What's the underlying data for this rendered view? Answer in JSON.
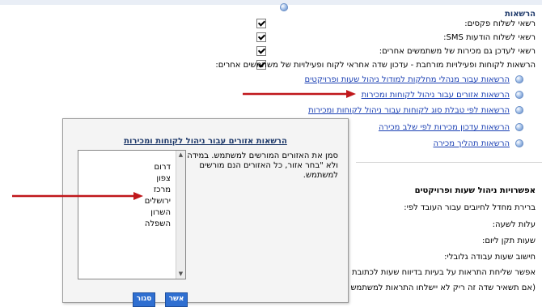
{
  "section_title": "הרשאות",
  "checkbox_rows": [
    {
      "label": "רשאי לשלוח פקסים:",
      "checked": true
    },
    {
      "label": "רשאי לשלוח הודעות SMS:",
      "checked": true
    },
    {
      "label": "רשאי לעדכן גם מכירות של משתמשים אחרים:",
      "checked": true
    },
    {
      "label": "הרשאות לקוחות ופעילויות מורחבת - עדכון שדה אחראי לקוח ופעילויות של משתמשים אחרים:",
      "checked": true
    }
  ],
  "links": [
    "הרשאות עבור מנהלי מחלקות למודול ניהול שעות ופרויקטים",
    "הרשאות אזורים עבור ניהול לקוחות ומכירות",
    "הרשאות לפי טבלת סוג לקוחות עבור ניהול לקוחות ומכירות",
    "הרשאות עדכון מכירות לפי שלב מכירה",
    "הרשאות תהליך מכירה"
  ],
  "subsection_title": "אפשרויות ניהול שעות ופרויקטים",
  "info_rows": [
    "ברירת מחדל לחיובים עבור העובד לפי:",
    "עלות לשעה:",
    "שעות תקן ליום:",
    "חישוב שעות עבודה גלובלי:",
    "אפשר שליחת התראות על בעיות בדיווח שעות לכתובת מייל זו",
    "(אם תשאיר שדה זה ריק לא יישלחו התראות למשתמש זה):"
  ],
  "dialog": {
    "title": "הרשאות אזורים עבור ניהול לקוחות ומכירות",
    "description": "סמן את האזורים המורשים למשתמש. במידה ולא \"בחר אזור, כל האזורים הנם מורשים למשתמש.",
    "regions": [
      "דרום",
      "צפון",
      "מרכז",
      "ירושלים",
      "השרון",
      "השפלה"
    ],
    "ok_label": "אשר",
    "close_label": "סגור"
  },
  "colors": {
    "link": "#1a3fb3",
    "button": "#2f6fd1",
    "arrow": "#c0171b",
    "title": "#1f3a6b"
  }
}
